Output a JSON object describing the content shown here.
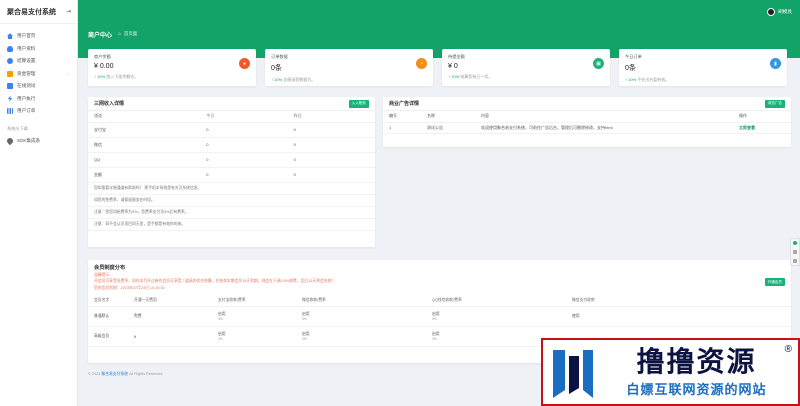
{
  "app": {
    "title": "聚合易支付系统"
  },
  "sidebar": {
    "items": [
      {
        "label": "用户首页",
        "icon": "home-icon",
        "color": "#3b82f6"
      },
      {
        "label": "用户资料",
        "icon": "user-icon",
        "color": "#3b82f6"
      },
      {
        "label": "结算设置",
        "icon": "settings-icon",
        "color": "#3b82f6"
      },
      {
        "label": "资金管理",
        "icon": "wallet-icon",
        "color": "#f59e0b"
      },
      {
        "label": "在线测试",
        "icon": "test-icon",
        "color": "#3b82f6"
      },
      {
        "label": "用户执行",
        "icon": "bolt-icon",
        "color": "#3b82f6"
      },
      {
        "label": "用户订单",
        "icon": "chart-icon",
        "color": "#3b82f6"
      }
    ],
    "section_label": "系统与下载",
    "extra_item": {
      "label": "SDK集成系",
      "icon": "pin-icon"
    }
  },
  "header": {
    "username": "刷模具"
  },
  "breadcrumb": {
    "title": "商户中心",
    "current": "首页面"
  },
  "stats": [
    {
      "label": "商户余额",
      "value": "¥ 0.00",
      "pct": "10%",
      "foot": "加入下面余额式。",
      "color": "#f05a28",
      "icon": "coin-icon"
    },
    {
      "label": "订单数据",
      "value": "0条",
      "pct": "10%",
      "foot": "总服采款数据为。",
      "color": "#f28f1b",
      "icon": "clock-icon"
    },
    {
      "label": "待提金额",
      "value": "¥ 0",
      "pct": "10%",
      "foot": "结算您有已一切。",
      "color": "#1fb37a",
      "icon": "card-icon"
    },
    {
      "label": "今日订单",
      "value": "0条",
      "pct": "10%",
      "foot": "不在出台盈有效。",
      "color": "#2f9ae0",
      "icon": "bar-icon"
    }
  ],
  "income": {
    "title": "三网收入详情",
    "button": "入入账前",
    "columns": [
      "通道",
      "今日",
      "昨日"
    ],
    "rows": [
      {
        "name": "支付宝",
        "today": "0",
        "yesterday": "0"
      },
      {
        "name": "微信",
        "today": "0",
        "yesterday": "0"
      },
      {
        "name": "QQ",
        "today": "0",
        "yesterday": "0"
      },
      {
        "name": "金额",
        "today": "0",
        "yesterday": "0"
      }
    ],
    "notes": [
      "您知需要详细通道有帮助吗？ 那手机本系统是有关注系统信息。",
      "如您的免费率，请保留服务在时段。",
      "注意：您您如始费率为3%，您费率支付功3%后有费率。",
      "注意：如不会认识项目同天里，是手都是有效你的来。"
    ]
  },
  "ads": {
    "title": "商业广告详情",
    "button": "浏览广告",
    "columns": [
      "编号",
      "名称",
      "内容",
      "操作"
    ],
    "rows": [
      {
        "id": "1",
        "name": "测试公告",
        "content": "欢迎使用聚合易支付系统，可前往广告后台，管理后可删除修改，支持html",
        "action": "立即查看"
      }
    ]
  },
  "member": {
    "title": "会员制度分布",
    "line1": "温馨提示：",
    "line2": "开会员可享受低费率，如在本月开过新的会员可享受二道高的优先结算，在结束本期会员15天到期，则会在下调0.5%收费，否后15天将会失效！",
    "line3": "您的会员到期：2023年07月23日 15:26:30",
    "button": "开通会员",
    "columns": [
      "会员名字",
      "开通一天费用",
      "支付宝收款/费率",
      "微信收款/费率",
      "QQ钱包收款/费率",
      "微信支付收款"
    ],
    "rows": [
      {
        "name": "普通默认",
        "price": "免费",
        "alipay": "启用",
        "alipay_rate": "3%",
        "wechat": "启用",
        "wechat_rate": "3%",
        "qq": "启用",
        "qq_rate": "3%",
        "action": "使用"
      },
      {
        "name": "高级会员",
        "price": "¥",
        "alipay": "启用",
        "alipay_rate": "2%",
        "wechat": "启用",
        "wechat_rate": "2%",
        "qq": "启用",
        "qq_rate": "2%",
        "action": ""
      }
    ]
  },
  "footer": {
    "copy": "© 2023",
    "link": "聚合易支付系统",
    "rights": "All Rights Reserved."
  },
  "watermark": {
    "big": "撸撸资源",
    "small": "白嫖互联网资源的网站",
    "reg": "®"
  }
}
